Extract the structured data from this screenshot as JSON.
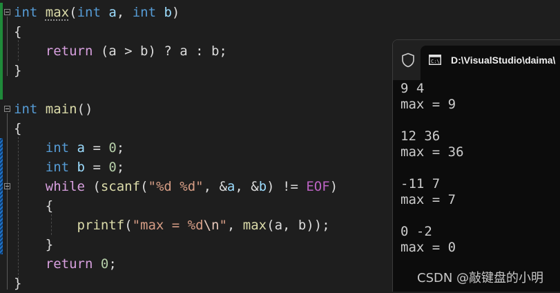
{
  "editor": {
    "function_max": {
      "sig_type": "int",
      "sig_name": "max",
      "sig_open": "(",
      "p1_type": "int",
      "p1_name": "a",
      "sep": ", ",
      "p2_type": "int",
      "p2_name": "b",
      "sig_close": ")",
      "brace_open": "{",
      "ret_kw": "return",
      "ret_expr": " (a > b) ? a : b;",
      "brace_close": "}"
    },
    "function_main": {
      "sig_type": "int",
      "sig_name": "main",
      "sig_parens": "()",
      "brace_open": "{",
      "decl_a_type": "int",
      "decl_a_name": "a",
      "decl_a_eq": " = ",
      "decl_a_val": "0",
      "decl_a_semi": ";",
      "decl_b_type": "int",
      "decl_b_name": "b",
      "decl_b_eq": " = ",
      "decl_b_val": "0",
      "decl_b_semi": ";",
      "while_kw": "while",
      "while_open": " (",
      "scanf_name": "scanf",
      "scanf_open": "(",
      "scanf_fmt": "\"%d %d\"",
      "scanf_sep1": ", &",
      "scanf_a": "a",
      "scanf_sep2": ", &",
      "scanf_b": "b",
      "scanf_close": ") != ",
      "eof_macro": "EOF",
      "while_close": ")",
      "loop_open": "{",
      "printf_name": "printf",
      "printf_open": "(",
      "printf_fmt_1": "\"max = %d",
      "printf_esc": "\\n",
      "printf_fmt_2": "\"",
      "printf_sep": ", ",
      "printf_call": "max",
      "printf_args": "(a, b));",
      "loop_close": "}",
      "return_kw": "return",
      "return_space": " ",
      "return_val": "0",
      "return_semi": ";",
      "brace_close": "}"
    }
  },
  "console": {
    "tab_title": "D:\\VisualStudio\\daima\\",
    "lines": [
      "9 4",
      "max = 9",
      "12 36",
      "max = 36",
      "-11 7",
      "max = 7",
      "0 -2",
      "max = 0"
    ]
  },
  "watermark": "CSDN @敲键盘的小明",
  "icons": {
    "shield": "shield-icon",
    "terminal": "terminal-icon",
    "fold": "collapse-icon"
  },
  "colors": {
    "keyword": "#569cd6",
    "control_keyword": "#d8a0df",
    "function": "#dcdcaa",
    "variable": "#9cdcfe",
    "number": "#b5cea8",
    "string": "#d69d85",
    "macro": "#bd63c5",
    "change_saved": "#1f8a3a",
    "change_unsaved": "#1e72c9"
  }
}
